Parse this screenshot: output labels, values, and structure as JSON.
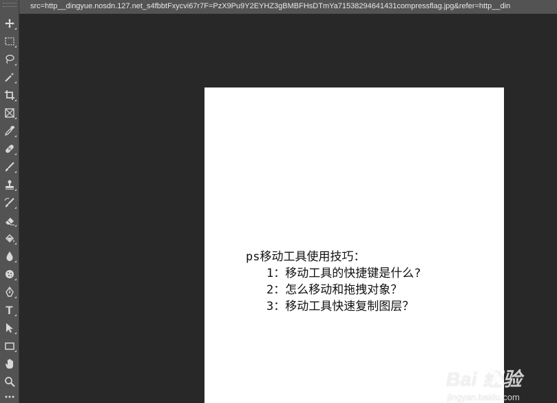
{
  "document_tab": {
    "title": "src=http__dingyue.nosdn.127.net_s4fbbtFxycvi67r7F=PzX9Pu9Y2EYHZ3gBMBFHsDTmYa71538294641431compressflag.jpg&refer=http__din"
  },
  "toolbar": {
    "tools": [
      {
        "name": "move-tool",
        "icon": "move-icon"
      },
      {
        "name": "marquee-tool",
        "icon": "rectangular-marquee-icon"
      },
      {
        "name": "lasso-tool",
        "icon": "lasso-icon"
      },
      {
        "name": "magic-wand-tool",
        "icon": "magic-wand-icon"
      },
      {
        "name": "crop-tool",
        "icon": "crop-icon"
      },
      {
        "name": "frame-tool",
        "icon": "frame-icon"
      },
      {
        "name": "eyedropper-tool",
        "icon": "eyedropper-icon"
      },
      {
        "name": "healing-brush-tool",
        "icon": "bandage-icon"
      },
      {
        "name": "brush-tool",
        "icon": "brush-icon"
      },
      {
        "name": "clone-stamp-tool",
        "icon": "stamp-icon"
      },
      {
        "name": "history-brush-tool",
        "icon": "history-brush-icon"
      },
      {
        "name": "eraser-tool",
        "icon": "eraser-icon"
      },
      {
        "name": "paint-bucket-tool",
        "icon": "paint-bucket-icon"
      },
      {
        "name": "blur-tool",
        "icon": "blur-drop-icon"
      },
      {
        "name": "sponge-tool",
        "icon": "sponge-icon"
      },
      {
        "name": "pen-tool",
        "icon": "pen-icon"
      },
      {
        "name": "type-tool",
        "icon": "type-icon"
      },
      {
        "name": "path-selection-tool",
        "icon": "path-selection-icon"
      },
      {
        "name": "rectangle-tool",
        "icon": "rectangle-icon"
      },
      {
        "name": "hand-tool",
        "icon": "hand-icon"
      },
      {
        "name": "zoom-tool",
        "icon": "zoom-icon"
      },
      {
        "name": "edit-toolbar",
        "icon": "more-icon"
      }
    ],
    "type_tool_glyph": "T"
  },
  "canvas": {
    "lines": [
      "ps移动工具使用技巧：",
      "1：移动工具的快捷键是什么?",
      "2：怎么移动和拖拽对象？",
      "3：移动工具快速复制图层？"
    ]
  },
  "watermark": {
    "logo_text": "Bai  经验",
    "url": "jingyan.baidu.com"
  }
}
